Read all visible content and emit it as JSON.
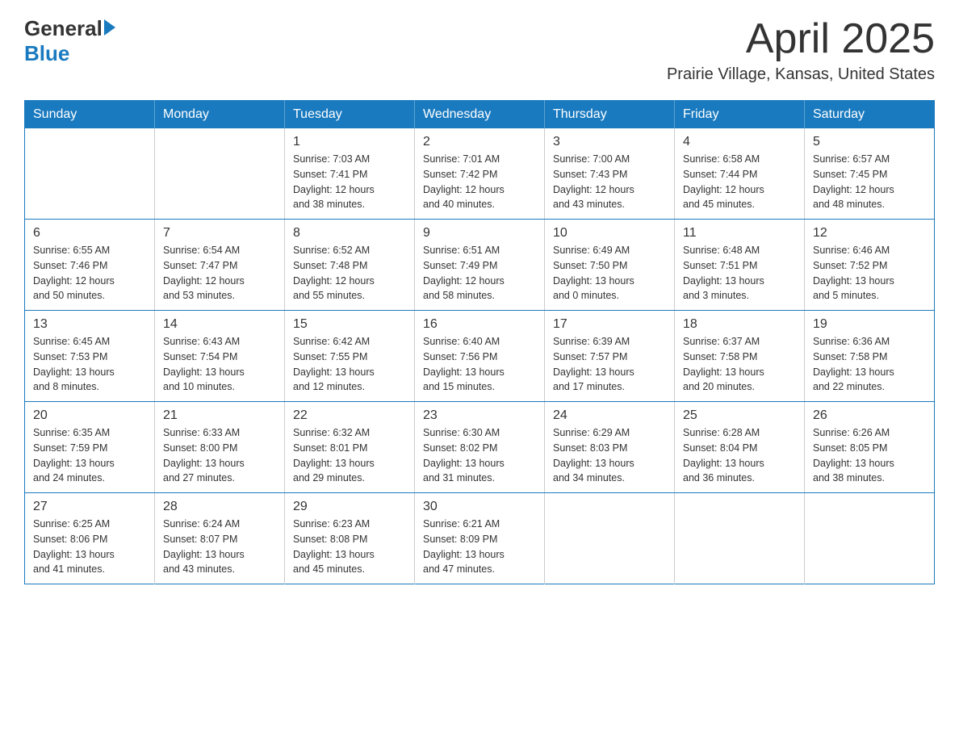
{
  "header": {
    "logo_general": "General",
    "logo_blue": "Blue",
    "title": "April 2025",
    "subtitle": "Prairie Village, Kansas, United States"
  },
  "weekdays": [
    "Sunday",
    "Monday",
    "Tuesday",
    "Wednesday",
    "Thursday",
    "Friday",
    "Saturday"
  ],
  "weeks": [
    [
      {
        "day": "",
        "info": ""
      },
      {
        "day": "",
        "info": ""
      },
      {
        "day": "1",
        "info": "Sunrise: 7:03 AM\nSunset: 7:41 PM\nDaylight: 12 hours\nand 38 minutes."
      },
      {
        "day": "2",
        "info": "Sunrise: 7:01 AM\nSunset: 7:42 PM\nDaylight: 12 hours\nand 40 minutes."
      },
      {
        "day": "3",
        "info": "Sunrise: 7:00 AM\nSunset: 7:43 PM\nDaylight: 12 hours\nand 43 minutes."
      },
      {
        "day": "4",
        "info": "Sunrise: 6:58 AM\nSunset: 7:44 PM\nDaylight: 12 hours\nand 45 minutes."
      },
      {
        "day": "5",
        "info": "Sunrise: 6:57 AM\nSunset: 7:45 PM\nDaylight: 12 hours\nand 48 minutes."
      }
    ],
    [
      {
        "day": "6",
        "info": "Sunrise: 6:55 AM\nSunset: 7:46 PM\nDaylight: 12 hours\nand 50 minutes."
      },
      {
        "day": "7",
        "info": "Sunrise: 6:54 AM\nSunset: 7:47 PM\nDaylight: 12 hours\nand 53 minutes."
      },
      {
        "day": "8",
        "info": "Sunrise: 6:52 AM\nSunset: 7:48 PM\nDaylight: 12 hours\nand 55 minutes."
      },
      {
        "day": "9",
        "info": "Sunrise: 6:51 AM\nSunset: 7:49 PM\nDaylight: 12 hours\nand 58 minutes."
      },
      {
        "day": "10",
        "info": "Sunrise: 6:49 AM\nSunset: 7:50 PM\nDaylight: 13 hours\nand 0 minutes."
      },
      {
        "day": "11",
        "info": "Sunrise: 6:48 AM\nSunset: 7:51 PM\nDaylight: 13 hours\nand 3 minutes."
      },
      {
        "day": "12",
        "info": "Sunrise: 6:46 AM\nSunset: 7:52 PM\nDaylight: 13 hours\nand 5 minutes."
      }
    ],
    [
      {
        "day": "13",
        "info": "Sunrise: 6:45 AM\nSunset: 7:53 PM\nDaylight: 13 hours\nand 8 minutes."
      },
      {
        "day": "14",
        "info": "Sunrise: 6:43 AM\nSunset: 7:54 PM\nDaylight: 13 hours\nand 10 minutes."
      },
      {
        "day": "15",
        "info": "Sunrise: 6:42 AM\nSunset: 7:55 PM\nDaylight: 13 hours\nand 12 minutes."
      },
      {
        "day": "16",
        "info": "Sunrise: 6:40 AM\nSunset: 7:56 PM\nDaylight: 13 hours\nand 15 minutes."
      },
      {
        "day": "17",
        "info": "Sunrise: 6:39 AM\nSunset: 7:57 PM\nDaylight: 13 hours\nand 17 minutes."
      },
      {
        "day": "18",
        "info": "Sunrise: 6:37 AM\nSunset: 7:58 PM\nDaylight: 13 hours\nand 20 minutes."
      },
      {
        "day": "19",
        "info": "Sunrise: 6:36 AM\nSunset: 7:58 PM\nDaylight: 13 hours\nand 22 minutes."
      }
    ],
    [
      {
        "day": "20",
        "info": "Sunrise: 6:35 AM\nSunset: 7:59 PM\nDaylight: 13 hours\nand 24 minutes."
      },
      {
        "day": "21",
        "info": "Sunrise: 6:33 AM\nSunset: 8:00 PM\nDaylight: 13 hours\nand 27 minutes."
      },
      {
        "day": "22",
        "info": "Sunrise: 6:32 AM\nSunset: 8:01 PM\nDaylight: 13 hours\nand 29 minutes."
      },
      {
        "day": "23",
        "info": "Sunrise: 6:30 AM\nSunset: 8:02 PM\nDaylight: 13 hours\nand 31 minutes."
      },
      {
        "day": "24",
        "info": "Sunrise: 6:29 AM\nSunset: 8:03 PM\nDaylight: 13 hours\nand 34 minutes."
      },
      {
        "day": "25",
        "info": "Sunrise: 6:28 AM\nSunset: 8:04 PM\nDaylight: 13 hours\nand 36 minutes."
      },
      {
        "day": "26",
        "info": "Sunrise: 6:26 AM\nSunset: 8:05 PM\nDaylight: 13 hours\nand 38 minutes."
      }
    ],
    [
      {
        "day": "27",
        "info": "Sunrise: 6:25 AM\nSunset: 8:06 PM\nDaylight: 13 hours\nand 41 minutes."
      },
      {
        "day": "28",
        "info": "Sunrise: 6:24 AM\nSunset: 8:07 PM\nDaylight: 13 hours\nand 43 minutes."
      },
      {
        "day": "29",
        "info": "Sunrise: 6:23 AM\nSunset: 8:08 PM\nDaylight: 13 hours\nand 45 minutes."
      },
      {
        "day": "30",
        "info": "Sunrise: 6:21 AM\nSunset: 8:09 PM\nDaylight: 13 hours\nand 47 minutes."
      },
      {
        "day": "",
        "info": ""
      },
      {
        "day": "",
        "info": ""
      },
      {
        "day": "",
        "info": ""
      }
    ]
  ]
}
